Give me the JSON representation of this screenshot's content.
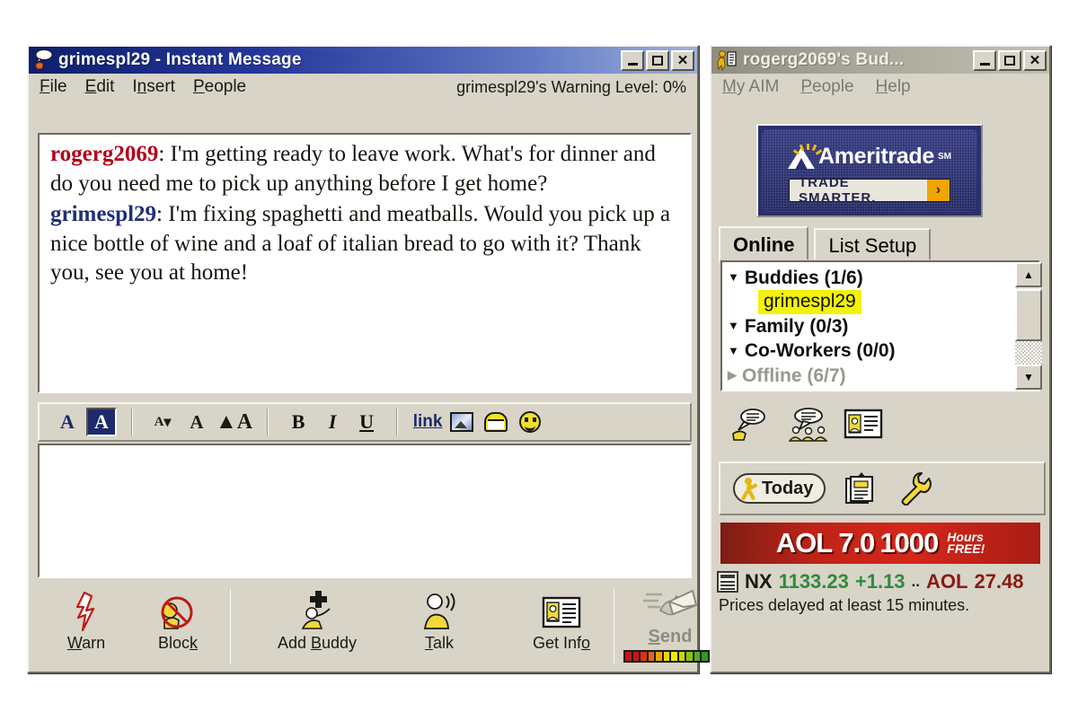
{
  "im_window": {
    "title": "grimespl29 - Instant Message",
    "title_icon": "im-buddy-icon",
    "window_buttons": {
      "minimize": "_",
      "maximize": "□",
      "close": "✕"
    },
    "menus": [
      {
        "label": "File",
        "accel": "F"
      },
      {
        "label": "Edit",
        "accel": "E"
      },
      {
        "label": "Insert",
        "accel": "n"
      },
      {
        "label": "People",
        "accel": "P"
      }
    ],
    "warning_level": "grimespl29's Warning Level: 0%",
    "messages": [
      {
        "screenname": "rogerg2069",
        "color": "#b3001b",
        "text": ": I'm getting ready to leave work.  What's for dinner and do you need me to pick up anything before I get home?"
      },
      {
        "screenname": "grimespl29",
        "color": "#1f2f7a",
        "text": ": I'm fixing spaghetti and meatballs. Would you pick up a nice bottle of wine and a loaf of italian bread to go with it? Thank you, see you at home!"
      }
    ],
    "format_toolbar": [
      {
        "name": "text-color-button",
        "glyph": "A",
        "selected": false
      },
      {
        "name": "background-color-button",
        "glyph": "A",
        "selected": true
      },
      {
        "name": "font-size-small-button",
        "glyph": "A",
        "selected": false
      },
      {
        "name": "font-size-medium-button",
        "glyph": "A",
        "selected": false
      },
      {
        "name": "font-size-large-button",
        "glyph": "A",
        "selected": false
      },
      {
        "name": "bold-button",
        "glyph": "B",
        "selected": false
      },
      {
        "name": "italic-button",
        "glyph": "I",
        "selected": false
      },
      {
        "name": "underline-button",
        "glyph": "U",
        "selected": false
      },
      {
        "name": "hyperlink-button",
        "glyph": "link",
        "selected": false
      },
      {
        "name": "insert-image-button",
        "glyph": "image",
        "selected": false
      },
      {
        "name": "insert-mail-button",
        "glyph": "mail",
        "selected": false
      },
      {
        "name": "insert-smiley-button",
        "glyph": "smiley",
        "selected": false
      }
    ],
    "compose_value": "",
    "compose_placeholder": "",
    "actions": [
      {
        "name": "warn-button",
        "label": "Warn",
        "accel": "W",
        "icon": "lightning-icon",
        "disabled": false
      },
      {
        "name": "block-button",
        "label": "Block",
        "accel": "k",
        "icon": "block-icon",
        "disabled": false
      },
      {
        "name": "add-buddy-button",
        "label": "Add Buddy",
        "accel": "B",
        "icon": "add-person-icon",
        "disabled": false
      },
      {
        "name": "talk-button",
        "label": "Talk",
        "accel": "T",
        "icon": "talking-person-icon",
        "disabled": false
      },
      {
        "name": "get-info-button",
        "label": "Get Info",
        "accel": "o",
        "icon": "info-card-icon",
        "disabled": false
      }
    ],
    "send": {
      "label": "Send",
      "accel": "S",
      "icon": "send-envelope-icon",
      "disabled": true
    },
    "send_meter_colors": [
      "#c01a12",
      "#c01a12",
      "#d9321c",
      "#e06a10",
      "#e8a40c",
      "#f0d40a",
      "#f0e80a",
      "#c8d40c",
      "#8ec40e",
      "#4fb022",
      "#2e9a28",
      "#1f8a22"
    ]
  },
  "buddy_window": {
    "title": "rogerg2069's Bud...",
    "title_icon": "buddy-list-icon",
    "active": false,
    "window_buttons": {
      "minimize": "_",
      "maximize": "□",
      "close": "✕"
    },
    "menus": [
      {
        "label": "My AIM",
        "accel": "M"
      },
      {
        "label": "People",
        "accel": "P"
      },
      {
        "label": "Help",
        "accel": "H"
      }
    ],
    "banner": {
      "brand": "Ameritrade",
      "trademark": "SM",
      "cta": "TRADE SMARTER.",
      "arrow": "›",
      "bg_color": "#2a2f6e",
      "accent_color": "#f0a500"
    },
    "tabs": [
      {
        "label": "Online",
        "active": true
      },
      {
        "label": "List Setup",
        "active": false
      }
    ],
    "list": [
      {
        "type": "group",
        "label": "Buddies (1/6)",
        "expanded": true,
        "offline": false
      },
      {
        "type": "buddy",
        "label": "grimespl29",
        "highlighted": true,
        "highlight_color": "#f2f20a"
      },
      {
        "type": "group",
        "label": "Family (0/3)",
        "expanded": true,
        "offline": false
      },
      {
        "type": "group",
        "label": "Co-Workers (0/0)",
        "expanded": true,
        "offline": false
      },
      {
        "type": "group",
        "label": "Offline (6/7)",
        "expanded": false,
        "offline": true
      }
    ],
    "list_buttons": [
      {
        "name": "send-im-button",
        "icon": "speech-bubble-hand-icon"
      },
      {
        "name": "chat-button",
        "icon": "group-chat-icon"
      },
      {
        "name": "get-info-button",
        "icon": "info-card-icon"
      }
    ],
    "toolbar": [
      {
        "name": "today-button",
        "label": "Today",
        "icon": "running-man-icon"
      },
      {
        "name": "notes-button",
        "label": "",
        "icon": "notepad-icon"
      },
      {
        "name": "preferences-button",
        "label": "",
        "icon": "wrench-icon"
      }
    ],
    "aol_banner": {
      "product": "AOL 7.0",
      "offer_number": "1000",
      "offer_line1": "Hours",
      "offer_line2": "FREE!",
      "bg_color": "#c02318"
    },
    "ticker": {
      "icon": "news-ticker-icon",
      "symbol": "NX",
      "value": "1133.23",
      "change": "+1.13",
      "separator": "..",
      "second_symbol": "AOL",
      "second_value": "27.48",
      "up_color": "#2f8a3a",
      "aol_color": "#8a1a12"
    },
    "disclaimer": "Prices delayed at least 15 minutes."
  }
}
